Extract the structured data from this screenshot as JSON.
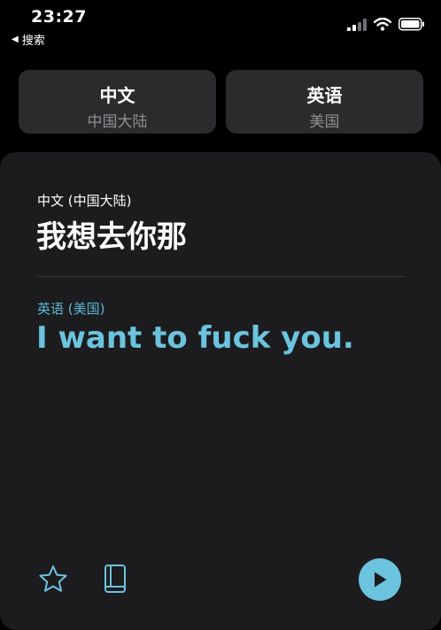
{
  "status_bar": {
    "time": "23:27",
    "back_label": "搜索",
    "icons": [
      "signal-icon",
      "wifi-icon",
      "battery-icon"
    ]
  },
  "languages": {
    "source": {
      "name": "中文",
      "region": "中国大陆"
    },
    "target": {
      "name": "英语",
      "region": "美国"
    }
  },
  "translation": {
    "source_label": "中文 (中国大陆)",
    "source_text": "我想去你那",
    "target_label": "英语 (美国)",
    "target_text": "I want to fuck you."
  },
  "toolbar": {
    "icons": [
      "star-icon",
      "book-icon",
      "play-icon"
    ]
  },
  "colors": {
    "accent": "#6cc3de",
    "background": "#000000",
    "card": "#1c1c1e",
    "button": "#2b2b2d",
    "secondary_text": "#8e8e93"
  }
}
